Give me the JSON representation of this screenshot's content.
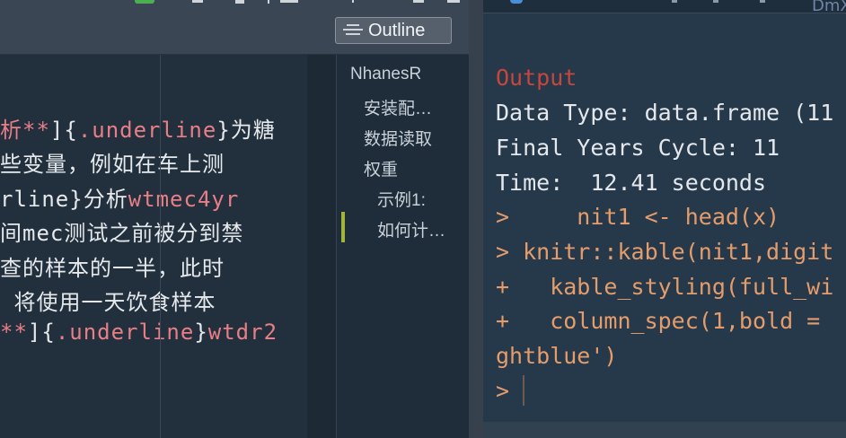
{
  "editor": {
    "outline_button_label": "Outline",
    "code_lines": [
      {
        "segments": [
          {
            "t": "析**",
            "c": "pink"
          },
          {
            "t": "]{",
            "c": "plain"
          },
          {
            "t": ".underline",
            "c": "pink"
          },
          {
            "t": "}为糖",
            "c": "plain"
          }
        ]
      },
      {
        "segments": [
          {
            "t": "些变量，例如在车上测",
            "c": "plain"
          }
        ]
      },
      {
        "segments": [
          {
            "t": "rline}分析",
            "c": "plain"
          },
          {
            "t": "wtmec4yr",
            "c": "pink"
          }
        ]
      },
      {
        "segments": [
          {
            "t": "间mec测试之前被分到禁",
            "c": "plain"
          }
        ]
      },
      {
        "segments": [
          {
            "t": "查的样本的一半，此时",
            "c": "plain"
          }
        ]
      },
      {
        "segments": [
          {
            "t": " 将使用一天饮食样本",
            "c": "plain"
          }
        ]
      },
      {
        "segments": [
          {
            "t": "**",
            "c": "pink"
          },
          {
            "t": "]{",
            "c": "plain"
          },
          {
            "t": ".underline",
            "c": "pink"
          },
          {
            "t": "}",
            "c": "plain"
          },
          {
            "t": "wtdr2",
            "c": "pink"
          }
        ]
      }
    ]
  },
  "outline": {
    "items": [
      {
        "label": "NhanesR"
      },
      {
        "label": "安装配…"
      },
      {
        "label": "数据读取"
      },
      {
        "label": "权重"
      },
      {
        "label": "示例1:"
      },
      {
        "label": "如何计…"
      }
    ]
  },
  "console": {
    "header_text": "DmX",
    "lines": [
      {
        "text": "Output",
        "style": "red"
      },
      {
        "text": "Data Type: data.frame (11",
        "style": "plain"
      },
      {
        "text": "Final Years Cycle: 11",
        "style": "plain"
      },
      {
        "text": "Time:  12.41 seconds",
        "style": "plain"
      },
      {
        "text": ">     nit1 <- head(x)",
        "style": "orange"
      },
      {
        "text": "> knitr::kable(nit1,digit",
        "style": "orange"
      },
      {
        "text": "+   kable_styling(full_wi",
        "style": "orange"
      },
      {
        "text": "+   column_spec(1,bold =",
        "style": "orange"
      },
      {
        "text": "ghtblue')",
        "style": "orange"
      },
      {
        "text": ">",
        "style": "orange"
      }
    ]
  },
  "colors": {
    "console_bg": "#26394b",
    "editor_bg": "#22303e",
    "keyword_pink": "#e87e86",
    "console_orange": "#e59c6b",
    "console_red": "#c7473c",
    "outline_active": "#a2b43a"
  }
}
